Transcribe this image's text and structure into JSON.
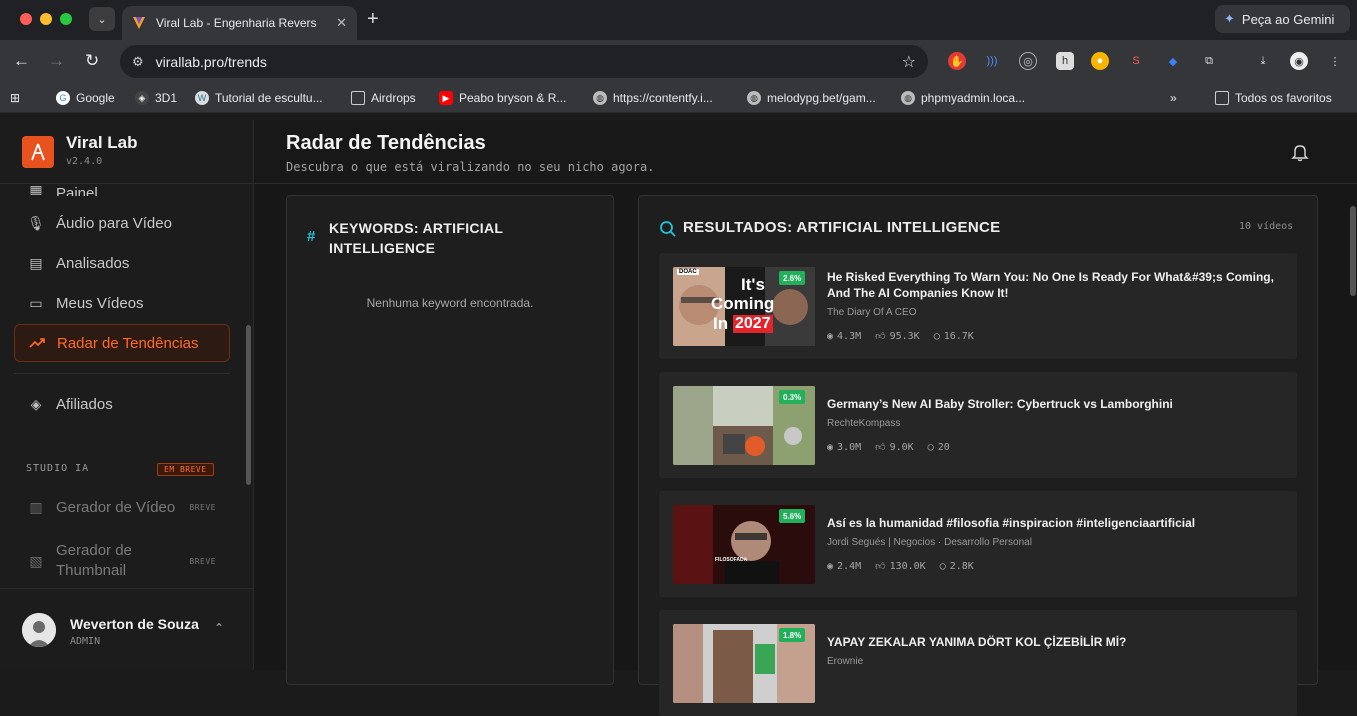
{
  "browser": {
    "tab_title": "Viral Lab - Engenharia Revers",
    "url": "virallab.pro/trends",
    "gemini_label": "Peça ao Gemini",
    "bookmarks": [
      {
        "label": "Google"
      },
      {
        "label": "3D1"
      },
      {
        "label": "Tutorial de escultu..."
      },
      {
        "label": "Airdrops"
      },
      {
        "label": "Peabo bryson & R..."
      },
      {
        "label": "https://contentfy.i..."
      },
      {
        "label": "melodypg.bet/gam..."
      },
      {
        "label": "phpmyadmin.loca..."
      }
    ],
    "all_bookmarks": "Todos os favoritos"
  },
  "sidebar": {
    "brand": "Viral Lab",
    "version": "v2.4.0",
    "items": [
      {
        "label": "Painel",
        "icon": "grid-icon"
      },
      {
        "label": "Áudio para Vídeo",
        "icon": "mic-icon"
      },
      {
        "label": "Analisados",
        "icon": "chart-doc-icon"
      },
      {
        "label": "Meus Vídeos",
        "icon": "video-icon"
      },
      {
        "label": "Radar de Tendências",
        "icon": "trending-icon"
      },
      {
        "label": "Afiliados",
        "icon": "tag-icon"
      }
    ],
    "section_label": "STUDIO IA",
    "section_badge": "EM BREVE",
    "studio_items": [
      {
        "label": "Gerador de Vídeo",
        "badge": "BREVE"
      },
      {
        "label": "Gerador de Thumbnail",
        "badge": "BREVE"
      }
    ],
    "user": {
      "name": "Weverton de Souza",
      "role": "ADMIN"
    }
  },
  "header": {
    "title": "Radar de Tendências",
    "subtitle": "Descubra o que está viralizando no seu nicho agora."
  },
  "keywords": {
    "title": "KEYWORDS: ARTIFICIAL INTELLIGENCE",
    "empty": "Nenhuma keyword encontrada."
  },
  "results": {
    "title": "RESULTADOS: ARTIFICIAL INTELLIGENCE",
    "count": "10 vídeos",
    "videos": [
      {
        "title": "He Risked Everything To Warn You: No One Is Ready For What&#39;s Coming, And The AI Companies Know It!",
        "channel": "The Diary Of A CEO",
        "views": "4.3M",
        "likes": "95.3K",
        "comments": "16.7K",
        "pct": "2.6%",
        "thumb_text": [
          "It's",
          "Coming",
          "In",
          "2027"
        ],
        "thumb_tag": "DOAC"
      },
      {
        "title": "Germany’s New AI Baby Stroller: Cybertruck vs Lamborghini",
        "channel": "RechteKompass",
        "views": "3.0M",
        "likes": "9.0K",
        "comments": "20",
        "pct": "0.3%"
      },
      {
        "title": "Así es la humanidad #filosofia #inspiracion #inteligenciaartificial",
        "channel": "Jordi Segués | Negocios · Desarrollo Personal",
        "views": "2.4M",
        "likes": "130.0K",
        "comments": "2.8K",
        "pct": "5.6%",
        "thumb_tag": "FILOSOFADA"
      },
      {
        "title": "YAPAY ZEKALAR YANIMA DÖRT KOL ÇİZEBİLİR Mİ?",
        "channel": "Erownie",
        "views": "",
        "likes": "",
        "comments": "",
        "pct": "1.8%"
      }
    ]
  },
  "colors": {
    "accent": "#ff6a2b",
    "brand": "#e8521f",
    "badge_green": "#22b05b",
    "cyan": "#1fc4d8"
  }
}
